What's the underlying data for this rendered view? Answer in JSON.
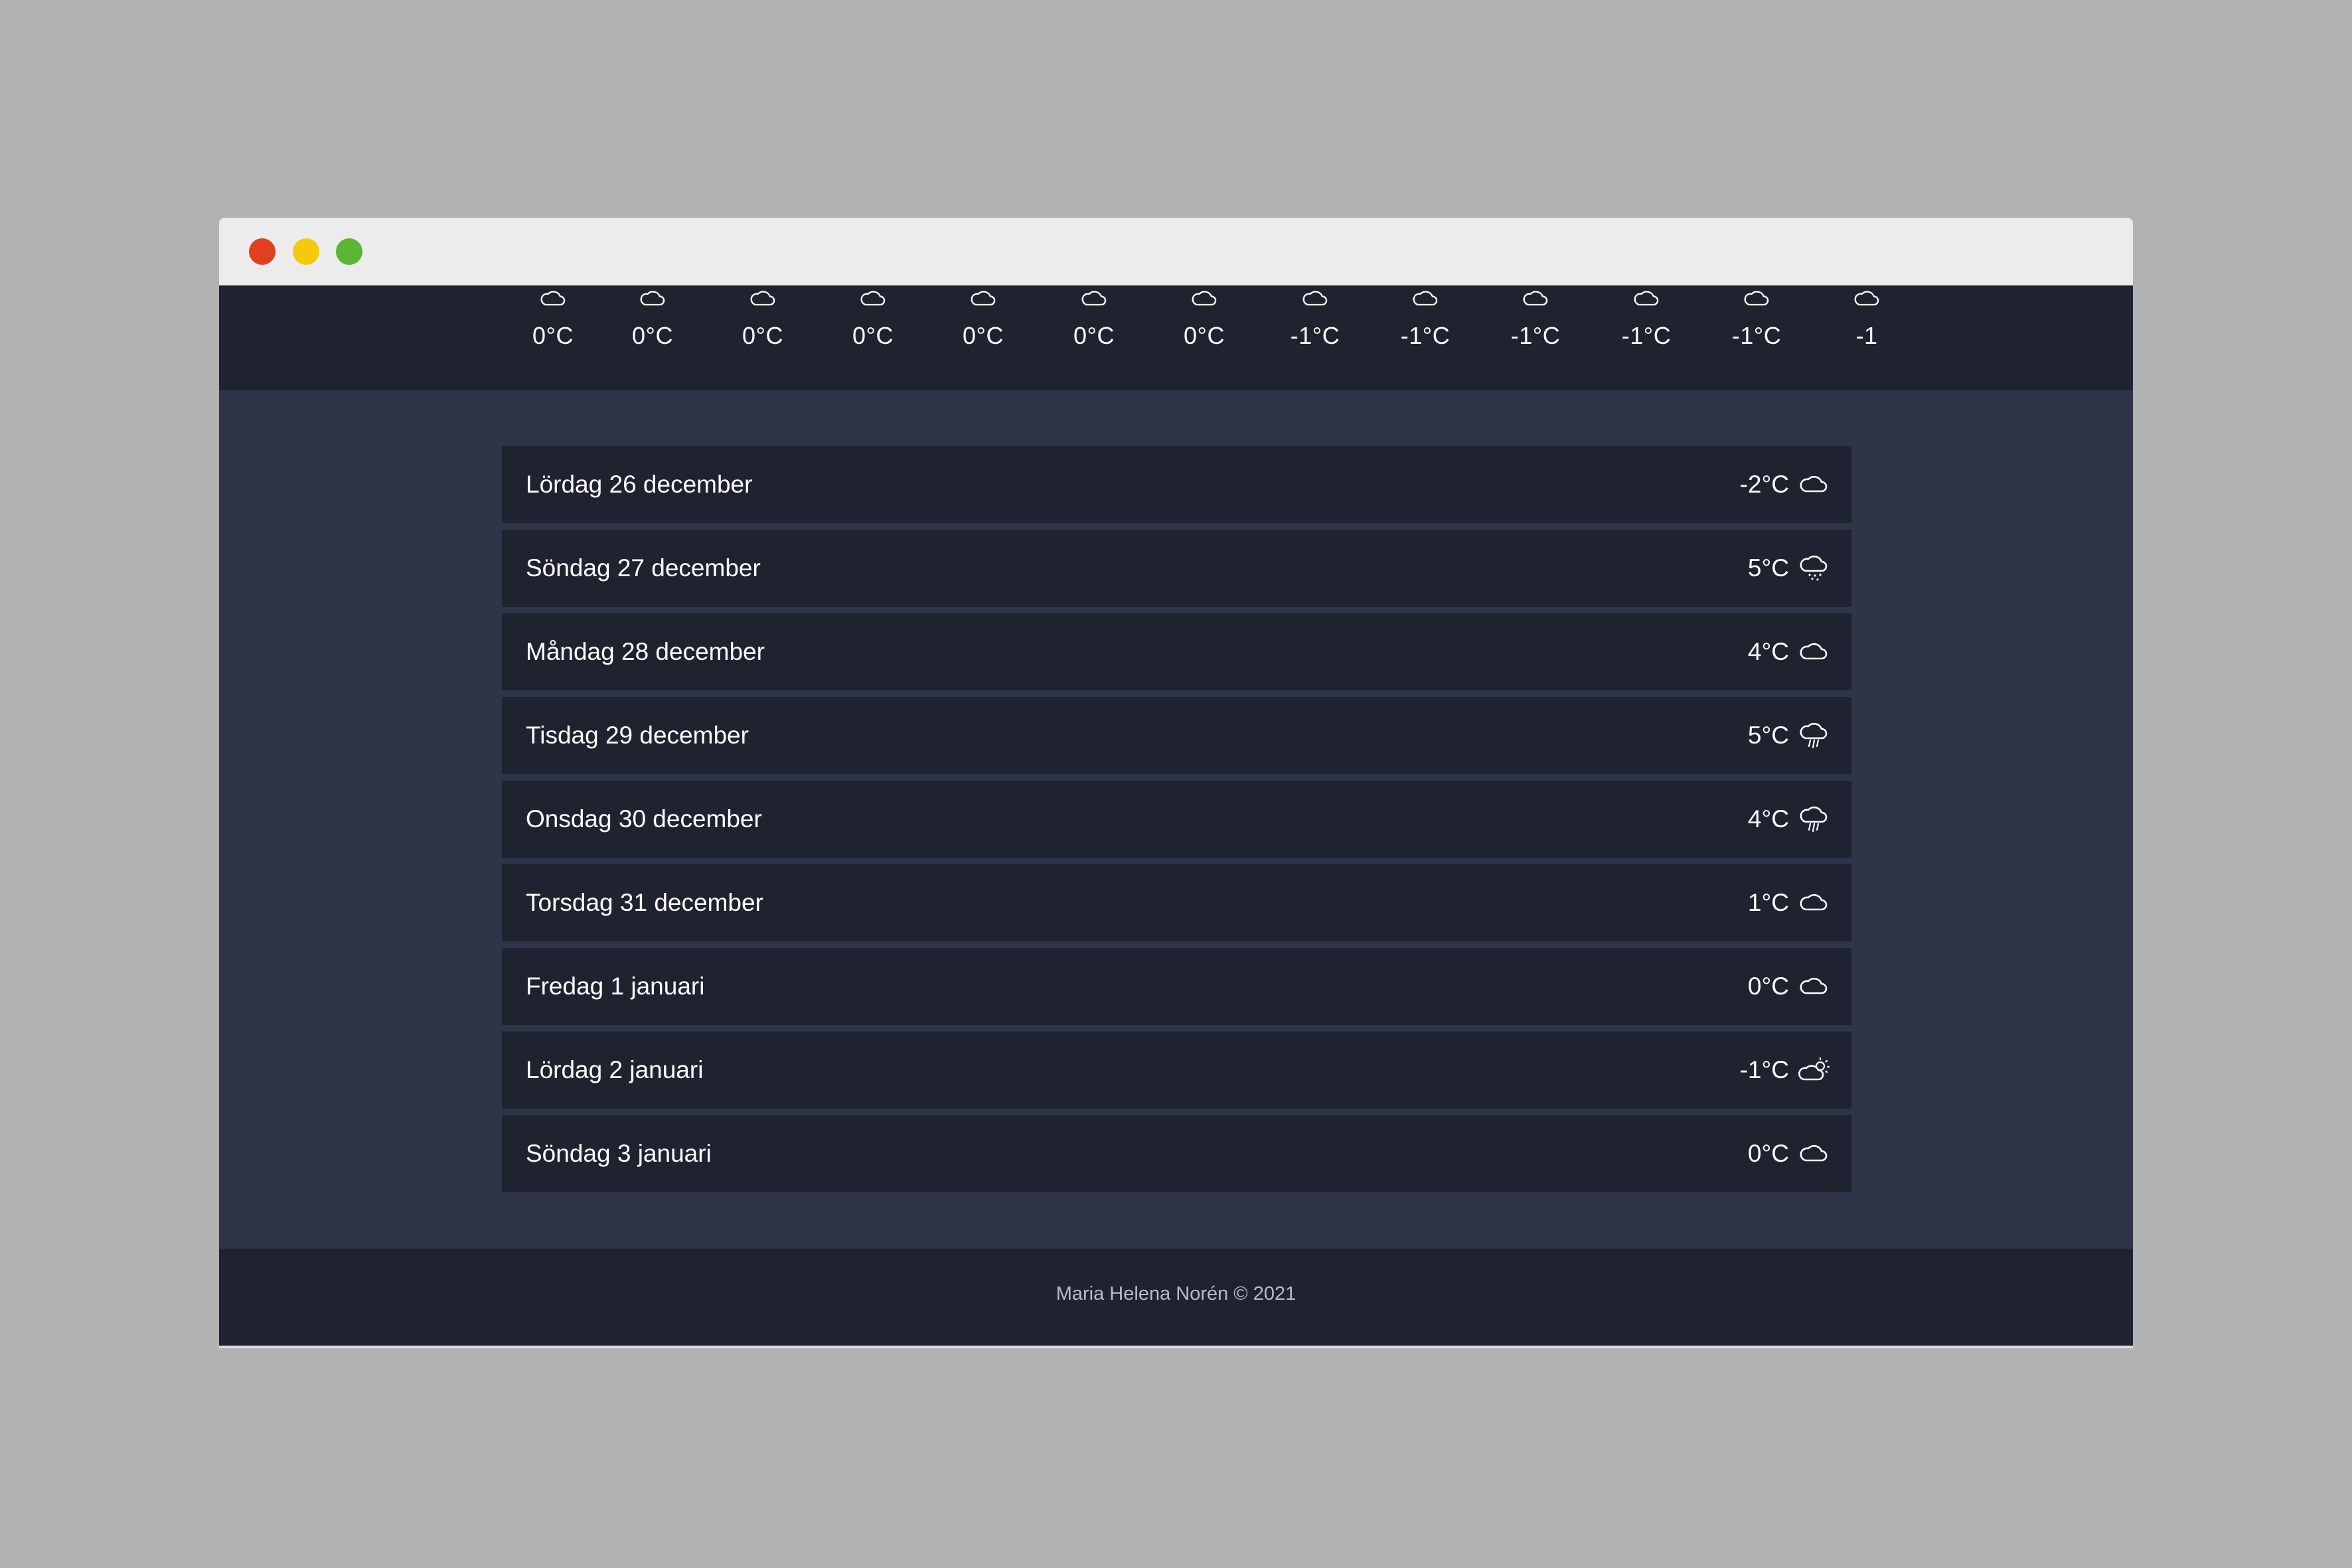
{
  "window": {
    "controls": [
      {
        "name": "close-button",
        "color": "#e0401f"
      },
      {
        "name": "minimize-button",
        "color": "#f7c90d"
      },
      {
        "name": "maximize-button",
        "color": "#5cb434"
      }
    ]
  },
  "hourly": [
    {
      "temp": "0°C",
      "icon": "cloud-icon"
    },
    {
      "temp": "0°C",
      "icon": "cloud-icon"
    },
    {
      "temp": "0°C",
      "icon": "cloud-icon"
    },
    {
      "temp": "0°C",
      "icon": "cloud-icon"
    },
    {
      "temp": "0°C",
      "icon": "cloud-icon"
    },
    {
      "temp": "0°C",
      "icon": "cloud-icon"
    },
    {
      "temp": "0°C",
      "icon": "cloud-icon"
    },
    {
      "temp": "-1°C",
      "icon": "cloud-icon"
    },
    {
      "temp": "-1°C",
      "icon": "cloud-icon"
    },
    {
      "temp": "-1°C",
      "icon": "cloud-icon"
    },
    {
      "temp": "-1°C",
      "icon": "cloud-icon"
    },
    {
      "temp": "-1°C",
      "icon": "cloud-icon"
    },
    {
      "temp": "-1",
      "icon": "cloud-icon"
    }
  ],
  "forecast": [
    {
      "day": "Lördag 26 december",
      "temp": "-2°C",
      "icon": "cloud-icon"
    },
    {
      "day": "Söndag 27 december",
      "temp": "5°C",
      "icon": "cloud-drizzle-icon"
    },
    {
      "day": "Måndag 28 december",
      "temp": "4°C",
      "icon": "cloud-icon"
    },
    {
      "day": "Tisdag 29 december",
      "temp": "5°C",
      "icon": "cloud-rain-icon"
    },
    {
      "day": "Onsdag 30 december",
      "temp": "4°C",
      "icon": "cloud-rain-icon"
    },
    {
      "day": "Torsdag 31 december",
      "temp": "1°C",
      "icon": "cloud-icon"
    },
    {
      "day": "Fredag 1 januari",
      "temp": "0°C",
      "icon": "cloud-icon"
    },
    {
      "day": "Lördag 2 januari",
      "temp": "-1°C",
      "icon": "partly-sunny-icon"
    },
    {
      "day": "Söndag 3 januari",
      "temp": "0°C",
      "icon": "cloud-icon"
    }
  ],
  "footer": {
    "text": "Maria Helena Norén © 2021"
  },
  "colors": {
    "background": "#b2b2b2",
    "page": "#2f3449",
    "panel": "#1f2330",
    "text": "#ffffff"
  }
}
